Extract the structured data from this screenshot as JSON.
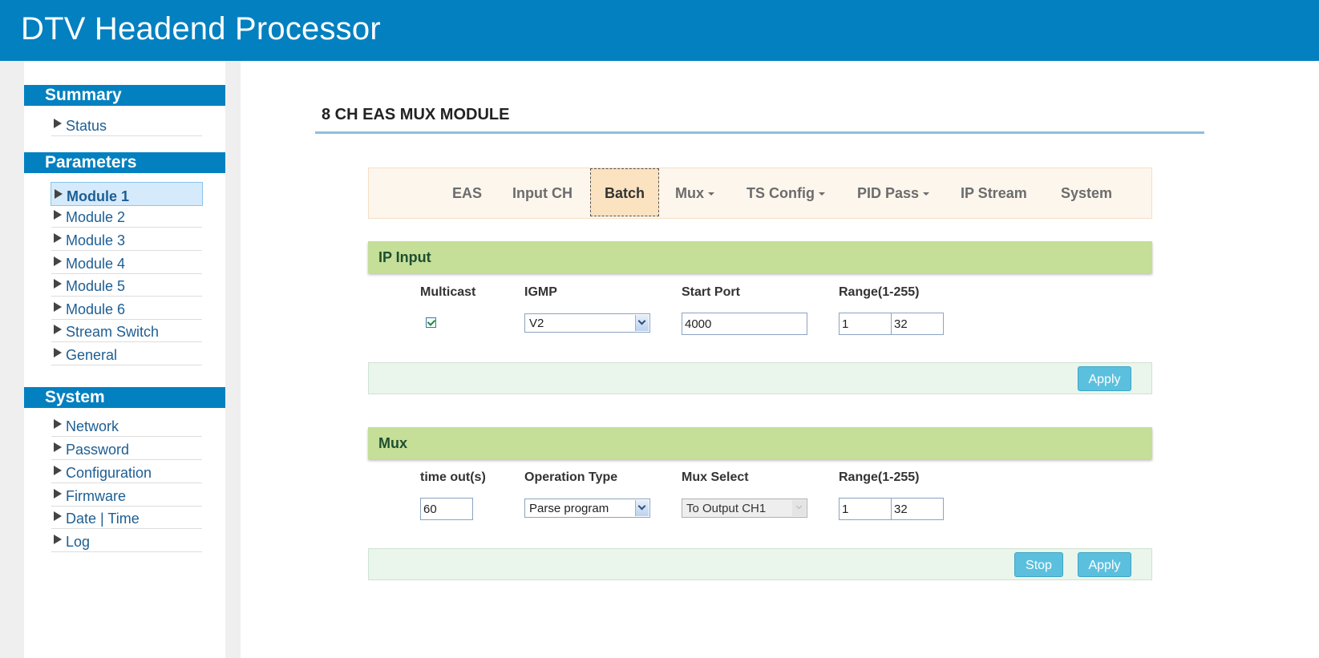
{
  "header": {
    "title": "DTV Headend Processor"
  },
  "sidebar": {
    "summary": {
      "title": "Summary",
      "items": [
        {
          "label": "Status"
        }
      ]
    },
    "parameters": {
      "title": "Parameters",
      "items": [
        {
          "label": "Module 1"
        },
        {
          "label": "Module 2"
        },
        {
          "label": "Module 3"
        },
        {
          "label": "Module 4"
        },
        {
          "label": "Module 5"
        },
        {
          "label": "Module 6"
        },
        {
          "label": "Stream Switch"
        },
        {
          "label": "General"
        }
      ]
    },
    "system": {
      "title": "System",
      "items": [
        {
          "label": "Network"
        },
        {
          "label": "Password"
        },
        {
          "label": "Configuration"
        },
        {
          "label": "Firmware"
        },
        {
          "label": "Date | Time"
        },
        {
          "label": "Log"
        }
      ]
    }
  },
  "main": {
    "page_title": "8 CH EAS MUX MODULE",
    "tabs": [
      {
        "label": "EAS"
      },
      {
        "label": "Input CH"
      },
      {
        "label": "Batch"
      },
      {
        "label": "Mux"
      },
      {
        "label": "TS Config"
      },
      {
        "label": "PID Pass"
      },
      {
        "label": "IP Stream"
      },
      {
        "label": "System"
      }
    ],
    "ip_input": {
      "title": "IP Input",
      "labels": {
        "multicast": "Multicast",
        "igmp": "IGMP",
        "start_port": "Start Port",
        "range": "Range(1-255)"
      },
      "multicast_checked": true,
      "igmp_value": "V2",
      "start_port_value": "4000",
      "range_from": "1",
      "range_to": "32",
      "apply_label": "Apply"
    },
    "mux": {
      "title": "Mux",
      "labels": {
        "timeout": "time out(s)",
        "operation_type": "Operation Type",
        "mux_select": "Mux Select",
        "range": "Range(1-255)"
      },
      "timeout_value": "60",
      "operation_type_value": "Parse program",
      "mux_select_value": "To Output CH1",
      "range_from": "1",
      "range_to": "32",
      "stop_label": "Stop",
      "apply_label": "Apply"
    }
  },
  "colors": {
    "header_blue": "#0380c0",
    "panel_green": "#c5de98",
    "button_cyan": "#5bc0de",
    "link_blue": "#1d5e93"
  }
}
